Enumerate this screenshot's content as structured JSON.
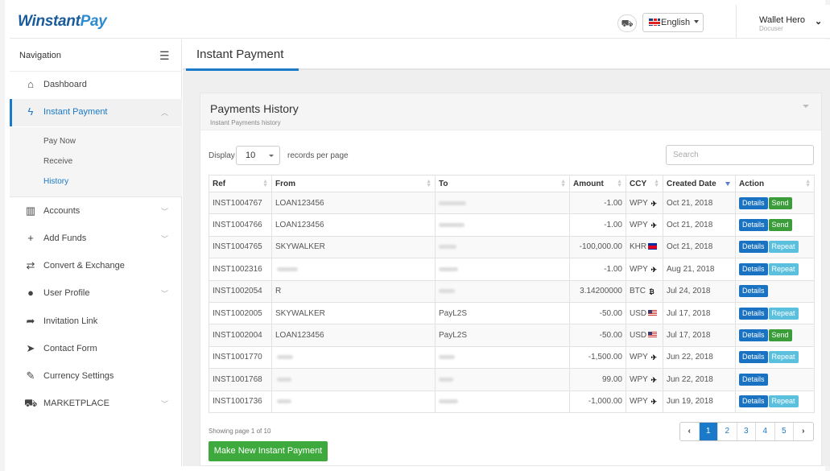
{
  "brand": {
    "name_a": "Winstant",
    "name_b": "Pay"
  },
  "header": {
    "cart_icon": "cart-icon",
    "language": "English",
    "user_name": "Wallet Hero",
    "user_role": "Docuser"
  },
  "sidebar": {
    "title": "Navigation",
    "items": [
      {
        "label": "Dashboard",
        "icon": "home-icon",
        "glyph": "⌂"
      },
      {
        "label": "Instant Payment",
        "icon": "bolt-icon",
        "glyph": "ϟ",
        "expanded": true
      },
      {
        "label": "Accounts",
        "icon": "table-icon",
        "glyph": "▥"
      },
      {
        "label": "Add Funds",
        "icon": "plus-icon",
        "glyph": "+"
      },
      {
        "label": "Convert & Exchange",
        "icon": "exchange-icon",
        "glyph": "⇄"
      },
      {
        "label": "User Profile",
        "icon": "user-icon",
        "glyph": "●"
      },
      {
        "label": "Invitation Link",
        "icon": "share-icon",
        "glyph": "➦"
      },
      {
        "label": "Contact Form",
        "icon": "send-icon",
        "glyph": "➤"
      },
      {
        "label": "Currency Settings",
        "icon": "wrench-icon",
        "glyph": "✎"
      },
      {
        "label": "MARKETPLACE",
        "icon": "cart-icon",
        "glyph": "⛟"
      }
    ],
    "subitems": [
      "Pay Now",
      "Receive",
      "History"
    ]
  },
  "page": {
    "title": "Instant Payment",
    "panel_title": "Payments History",
    "panel_subtitle": "Instant Payments history"
  },
  "table_controls": {
    "display_label": "Display",
    "page_size": "10",
    "records_label": "records per page",
    "search_placeholder": "Search"
  },
  "table": {
    "columns": [
      "Ref",
      "From",
      "To",
      "Amount",
      "CCY",
      "Created Date",
      "Action"
    ],
    "rows": [
      {
        "ref": "INST1004767",
        "from": "LOAN123456",
        "to": "",
        "amount": "-1.00",
        "ccy": "WPY",
        "date": "Oct 21, 2018",
        "actions": [
          "Details",
          "Send"
        ]
      },
      {
        "ref": "INST1004766",
        "from": "LOAN123456",
        "to": "",
        "amount": "-1.00",
        "ccy": "WPY",
        "date": "Oct 21, 2018",
        "actions": [
          "Details",
          "Send"
        ]
      },
      {
        "ref": "INST1004765",
        "from": "SKYWALKER",
        "to": "",
        "amount": "-100,000.00",
        "ccy": "KHR",
        "date": "Oct 21, 2018",
        "actions": [
          "Details",
          "Repeat"
        ]
      },
      {
        "ref": "INST1002316",
        "from": "",
        "to": "",
        "amount": "-1.00",
        "ccy": "WPY",
        "date": "Aug 21, 2018",
        "actions": [
          "Details",
          "Repeat"
        ]
      },
      {
        "ref": "INST1002054",
        "from": "R",
        "to": "",
        "amount": "3.14200000",
        "ccy": "BTC",
        "date": "Jul 24, 2018",
        "actions": [
          "Details"
        ]
      },
      {
        "ref": "INST1002005",
        "from": "SKYWALKER",
        "to": "PayL2S",
        "amount": "-50.00",
        "ccy": "USD",
        "date": "Jul 17, 2018",
        "actions": [
          "Details",
          "Repeat"
        ]
      },
      {
        "ref": "INST1002004",
        "from": "LOAN123456",
        "to": "PayL2S",
        "amount": "-50.00",
        "ccy": "USD",
        "date": "Jul 17, 2018",
        "actions": [
          "Details",
          "Send"
        ]
      },
      {
        "ref": "INST1001770",
        "from": "",
        "to": "",
        "amount": "-1,500.00",
        "ccy": "WPY",
        "date": "Jun 22, 2018",
        "actions": [
          "Details",
          "Repeat"
        ]
      },
      {
        "ref": "INST1001768",
        "from": "",
        "to": "",
        "amount": "99.00",
        "ccy": "WPY",
        "date": "Jun 22, 2018",
        "actions": [
          "Details"
        ]
      },
      {
        "ref": "INST1001736",
        "from": "",
        "to": "",
        "amount": "-1,000.00",
        "ccy": "WPY",
        "date": "Jun 19, 2018",
        "actions": [
          "Details",
          "Repeat"
        ]
      }
    ]
  },
  "footer": {
    "showing": "Showing page 1 of 10",
    "make_button": "Make New Instant Payment",
    "pages": [
      "1",
      "2",
      "3",
      "4",
      "5"
    ],
    "current_page": "1"
  }
}
